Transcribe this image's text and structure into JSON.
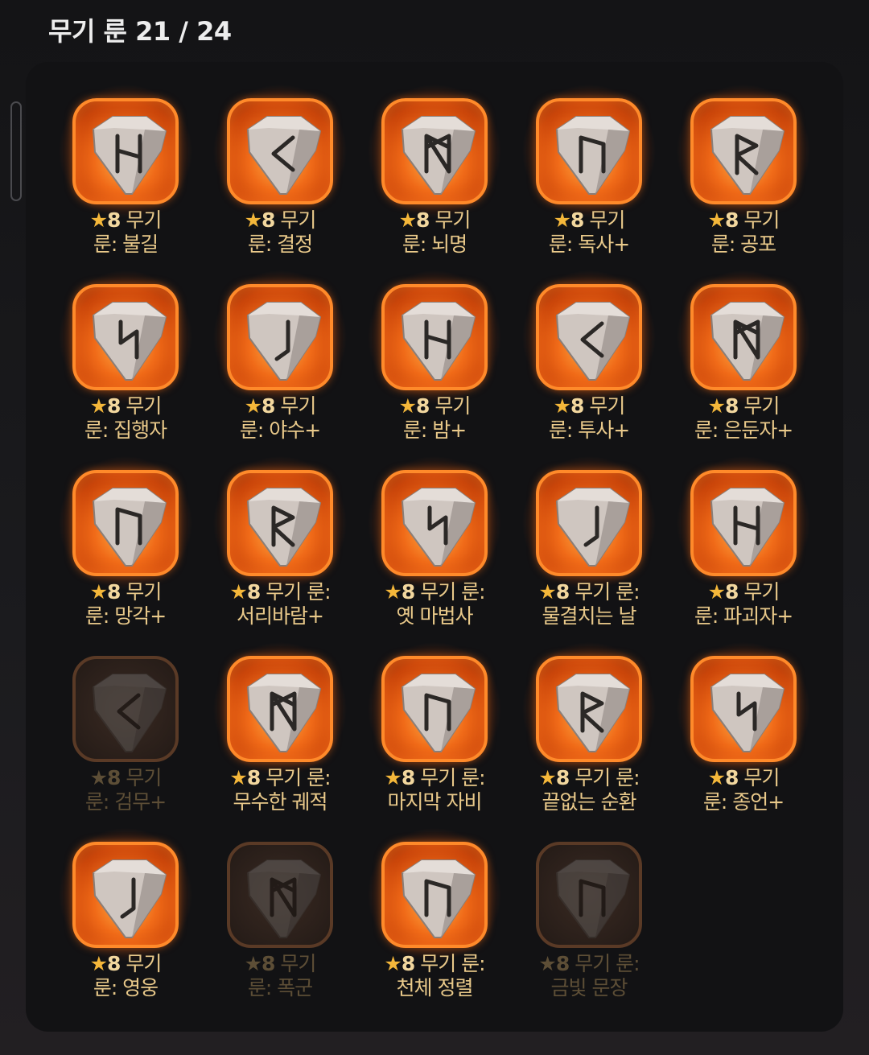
{
  "header": {
    "title": "무기 룬 21 / 24"
  },
  "runes": [
    {
      "stars": "8",
      "line1": "무기",
      "line2": "룬: 불길",
      "glyph": "H",
      "unlocked": true
    },
    {
      "stars": "8",
      "line1": "무기",
      "line2": "룬: 결정",
      "glyph": "<",
      "unlocked": true
    },
    {
      "stars": "8",
      "line1": "무기",
      "line2": "룬: 뇌명",
      "glyph": "M",
      "unlocked": true
    },
    {
      "stars": "8",
      "line1": "무기",
      "line2": "룬: 독사+",
      "glyph": "N",
      "unlocked": true
    },
    {
      "stars": "8",
      "line1": "무기",
      "line2": "룬: 공포",
      "glyph": "R",
      "unlocked": true
    },
    {
      "stars": "8",
      "line1": "무기",
      "line2": "룬: 집행자",
      "glyph": "S",
      "unlocked": true
    },
    {
      "stars": "8",
      "line1": "무기",
      "line2": "룬: 야수+",
      "glyph": "J",
      "unlocked": true
    },
    {
      "stars": "8",
      "line1": "무기",
      "line2": "룬: 밤+",
      "glyph": "H",
      "unlocked": true
    },
    {
      "stars": "8",
      "line1": "무기",
      "line2": "룬: 투사+",
      "glyph": "<",
      "unlocked": true
    },
    {
      "stars": "8",
      "line1": "무기",
      "line2": "룬: 은둔자+",
      "glyph": "M",
      "unlocked": true
    },
    {
      "stars": "8",
      "line1": "무기",
      "line2": "룬: 망각+",
      "glyph": "N",
      "unlocked": true
    },
    {
      "stars": "8",
      "line1": "무기 룬:",
      "line2": "서리바람+",
      "glyph": "R",
      "unlocked": true
    },
    {
      "stars": "8",
      "line1": "무기 룬:",
      "line2": "옛 마법사",
      "glyph": "S",
      "unlocked": true
    },
    {
      "stars": "8",
      "line1": "무기 룬:",
      "line2": "물결치는 날",
      "glyph": "J",
      "unlocked": true
    },
    {
      "stars": "8",
      "line1": "무기",
      "line2": "룬: 파괴자+",
      "glyph": "H",
      "unlocked": true
    },
    {
      "stars": "8",
      "line1": "무기",
      "line2": "룬: 검무+",
      "glyph": "<",
      "unlocked": false
    },
    {
      "stars": "8",
      "line1": "무기 룬:",
      "line2": "무수한 궤적",
      "glyph": "M",
      "unlocked": true
    },
    {
      "stars": "8",
      "line1": "무기 룬:",
      "line2": "마지막 자비",
      "glyph": "N",
      "unlocked": true
    },
    {
      "stars": "8",
      "line1": "무기 룬:",
      "line2": "끝없는 순환",
      "glyph": "R",
      "unlocked": true
    },
    {
      "stars": "8",
      "line1": "무기",
      "line2": "룬: 종언+",
      "glyph": "S",
      "unlocked": true
    },
    {
      "stars": "8",
      "line1": "무기",
      "line2": "룬: 영웅",
      "glyph": "J",
      "unlocked": true
    },
    {
      "stars": "8",
      "line1": "무기",
      "line2": "룬: 폭군",
      "glyph": "M",
      "unlocked": false
    },
    {
      "stars": "8",
      "line1": "무기 룬:",
      "line2": "천체 정렬",
      "glyph": "N",
      "unlocked": true
    },
    {
      "stars": "8",
      "line1": "무기 룬:",
      "line2": "금빛 문장",
      "glyph": "N",
      "unlocked": false
    }
  ]
}
